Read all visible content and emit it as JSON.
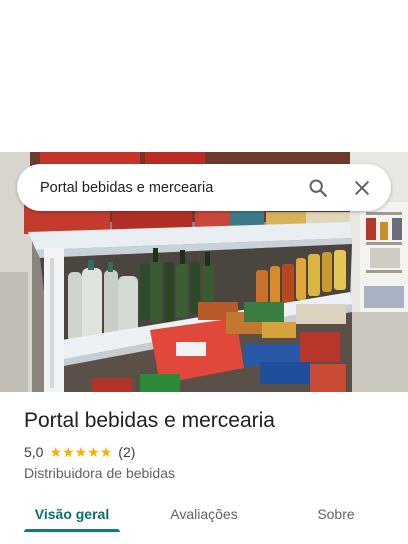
{
  "search": {
    "query": "Portal bebidas e mercearia"
  },
  "icons": {
    "search": "search-icon",
    "close": "close-icon",
    "star": "star-icon"
  },
  "place": {
    "name": "Portal bebidas e mercearia",
    "rating": "5,0",
    "stars": 5,
    "review_count": "(2)",
    "category": "Distribuidora de bebidas"
  },
  "tabs": [
    {
      "label": "Visão geral",
      "active": true
    },
    {
      "label": "Avaliações",
      "active": false
    },
    {
      "label": "Sobre",
      "active": false
    }
  ],
  "colors": {
    "accent": "#0b7b7b",
    "star": "#f5b000",
    "text": "#202124"
  }
}
